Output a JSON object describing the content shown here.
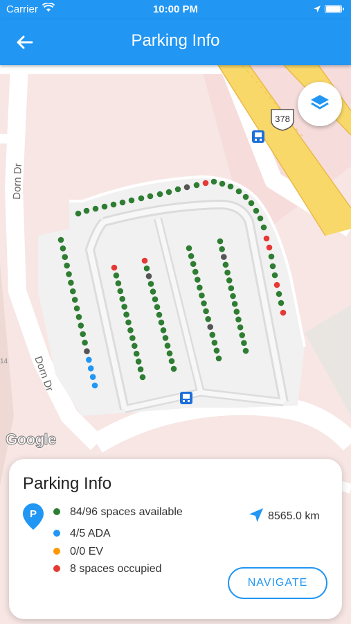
{
  "status_bar": {
    "carrier": "Carrier",
    "time": "10:00 PM"
  },
  "app_bar": {
    "title": "Parking Info"
  },
  "map": {
    "road_labels": [
      "Dorn Dr",
      "Dorn Dr"
    ],
    "highway_shield": "378",
    "edge_label": "14",
    "attribution": "Google"
  },
  "info_card": {
    "title": "Parking Info",
    "pin_letter": "P",
    "stats": [
      {
        "text": "84/96 spaces available",
        "color": "#2e7d32"
      },
      {
        "text": "4/5 ADA",
        "color": "#2196f3"
      },
      {
        "text": "0/0 EV",
        "color": "#ff9800"
      },
      {
        "text": "8 spaces occupied",
        "color": "#e53935"
      }
    ],
    "distance": "8565.0 km",
    "navigate_label": "NAVIGATE"
  },
  "colors": {
    "accent": "#2196f3",
    "available": "#2e7d32",
    "ada": "#2196f3",
    "ev": "#ff9800",
    "occupied": "#e53935",
    "unknown": "#555555"
  }
}
